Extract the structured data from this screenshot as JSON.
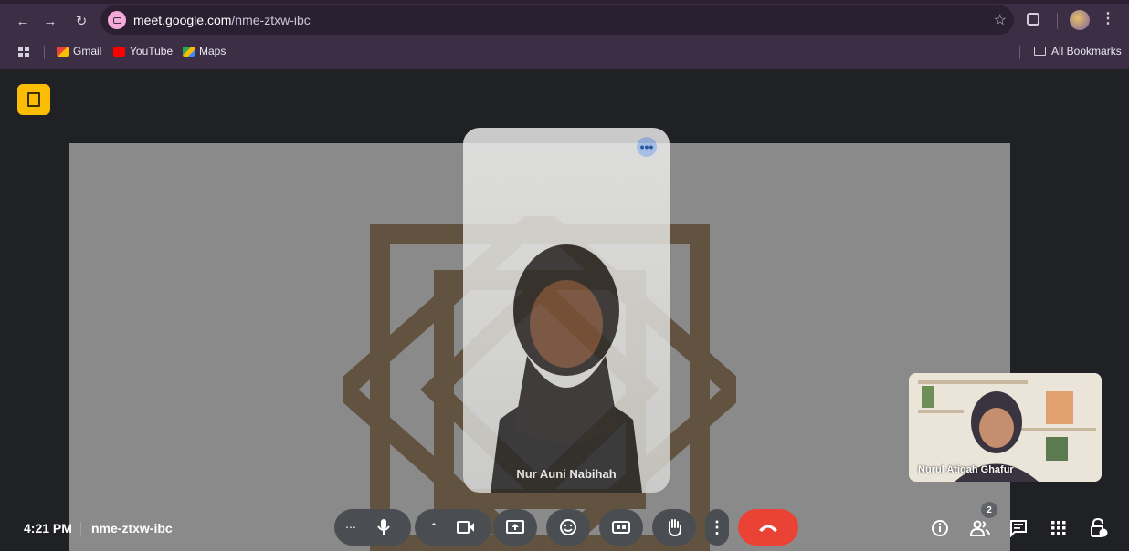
{
  "browser": {
    "url_host": "meet.google.com",
    "url_path": "/nme-ztxw-ibc",
    "bookmarks": [
      {
        "label": "Gmail",
        "icon": "gmail-icon",
        "color": "#ea4335"
      },
      {
        "label": "YouTube",
        "icon": "youtube-icon",
        "color": "#ff0000"
      },
      {
        "label": "Maps",
        "icon": "maps-icon",
        "color": "#34a853"
      }
    ],
    "all_bookmarks_label": "All Bookmarks"
  },
  "meet": {
    "main_participant_name": "Nur Auni Nabihah",
    "self_participant_name": "Nurul Atiqah Ghafur",
    "tile_options_label": "•••",
    "time": "4:21 PM",
    "meeting_code": "nme-ztxw-ibc",
    "participant_count": "2",
    "leave_color": "#ea4335",
    "accent_color": "#fbbc04"
  }
}
